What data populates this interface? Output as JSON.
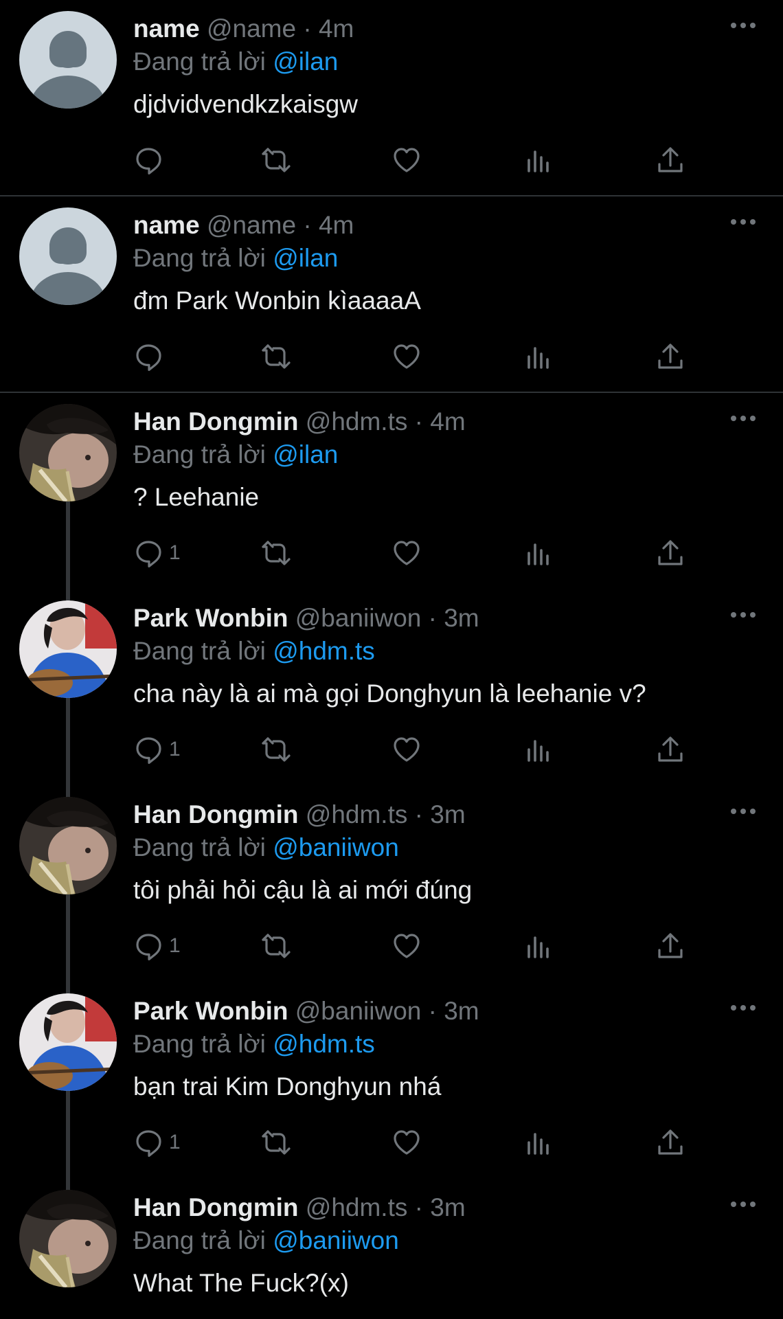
{
  "tweets": [
    {
      "display_name": "name",
      "handle": "@name",
      "time": "4m",
      "reply_prefix": "Đang trả lời",
      "reply_to": "@ilan",
      "text": "djdvidvendkzkaisgw",
      "reply_count": "",
      "avatar": "default-avatar"
    },
    {
      "display_name": "name",
      "handle": "@name",
      "time": "4m",
      "reply_prefix": "Đang trả lời",
      "reply_to": "@ilan",
      "text": "đm Park Wonbin kìaaaaA",
      "reply_count": "",
      "avatar": "default-avatar"
    },
    {
      "display_name": "Han Dongmin",
      "handle": "@hdm.ts",
      "time": "4m",
      "reply_prefix": "Đang trả lời",
      "reply_to": "@ilan",
      "text": "? Leehanie",
      "reply_count": "1",
      "avatar": "photo-hdm"
    },
    {
      "display_name": "Park Wonbin",
      "handle": "@baniiwon",
      "time": "3m",
      "reply_prefix": "Đang trả lời",
      "reply_to": "@hdm.ts",
      "text": "cha này là ai mà gọi Donghyun là leehanie v?",
      "reply_count": "1",
      "avatar": "photo-pwb"
    },
    {
      "display_name": "Han Dongmin",
      "handle": "@hdm.ts",
      "time": "3m",
      "reply_prefix": "Đang trả lời",
      "reply_to": "@baniiwon",
      "text": "tôi phải hỏi cậu là ai mới đúng",
      "reply_count": "1",
      "avatar": "photo-hdm"
    },
    {
      "display_name": "Park Wonbin",
      "handle": "@baniiwon",
      "time": "3m",
      "reply_prefix": "Đang trả lời",
      "reply_to": "@hdm.ts",
      "text": "bạn trai Kim Donghyun nhá",
      "reply_count": "1",
      "avatar": "photo-pwb"
    },
    {
      "display_name": "Han Dongmin",
      "handle": "@hdm.ts",
      "time": "3m",
      "reply_prefix": "Đang trả lời",
      "reply_to": "@baniiwon",
      "text": "What The Fuck?(x)",
      "reply_count": "",
      "avatar": "photo-hdm"
    }
  ],
  "separator": "·",
  "icons": [
    "reply-icon",
    "retweet-icon",
    "like-icon",
    "views-icon",
    "share-icon",
    "more-icon"
  ],
  "colors": {
    "background": "#000000",
    "text": "#e7e9ea",
    "secondary": "#71767b",
    "accent": "#1d9bf0",
    "divider": "#2f3336"
  }
}
